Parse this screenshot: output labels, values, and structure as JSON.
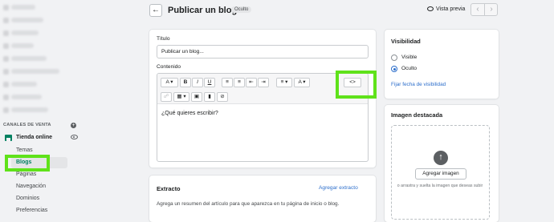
{
  "sidebar": {
    "section_heading": "CANALES DE VENTA",
    "store_item": "Tienda online",
    "sub_items": [
      "Temas",
      "Blogs",
      "Páginas",
      "Navegación",
      "Dominios",
      "Preferencias"
    ],
    "active_item": "Blogs"
  },
  "header": {
    "title": "Publicar un blog...",
    "status_badge": "Oculto",
    "preview_label": "Vista previa"
  },
  "form": {
    "title_label": "Título",
    "title_value": "Publicar un blog...",
    "content_label": "Contenido",
    "editor_placeholder": "¿Qué quieres escribir?",
    "toolbar": {
      "font": "A",
      "bold": "B",
      "italic": "I",
      "underline": "U",
      "text_color": "A",
      "html_toggle": "<>"
    }
  },
  "excerpt": {
    "title": "Extracto",
    "add_link": "Agregar extracto",
    "description": "Agrega un resumen del artículo para que aparezca en tu página de inicio o blog."
  },
  "visibility": {
    "title": "Visibilidad",
    "options": [
      "Visible",
      "Oculto"
    ],
    "selected": "Oculto",
    "set_date_link": "Fijar fecha de visibilidad"
  },
  "featured_image": {
    "title": "Imagen destacada",
    "button": "Agregar imagen",
    "hint": "o arrastra y suelta la imagen que deseas subir"
  },
  "colors": {
    "accent_green": "#008060",
    "link_blue": "#2c6ecb",
    "highlight_green": "#5fe21a"
  }
}
